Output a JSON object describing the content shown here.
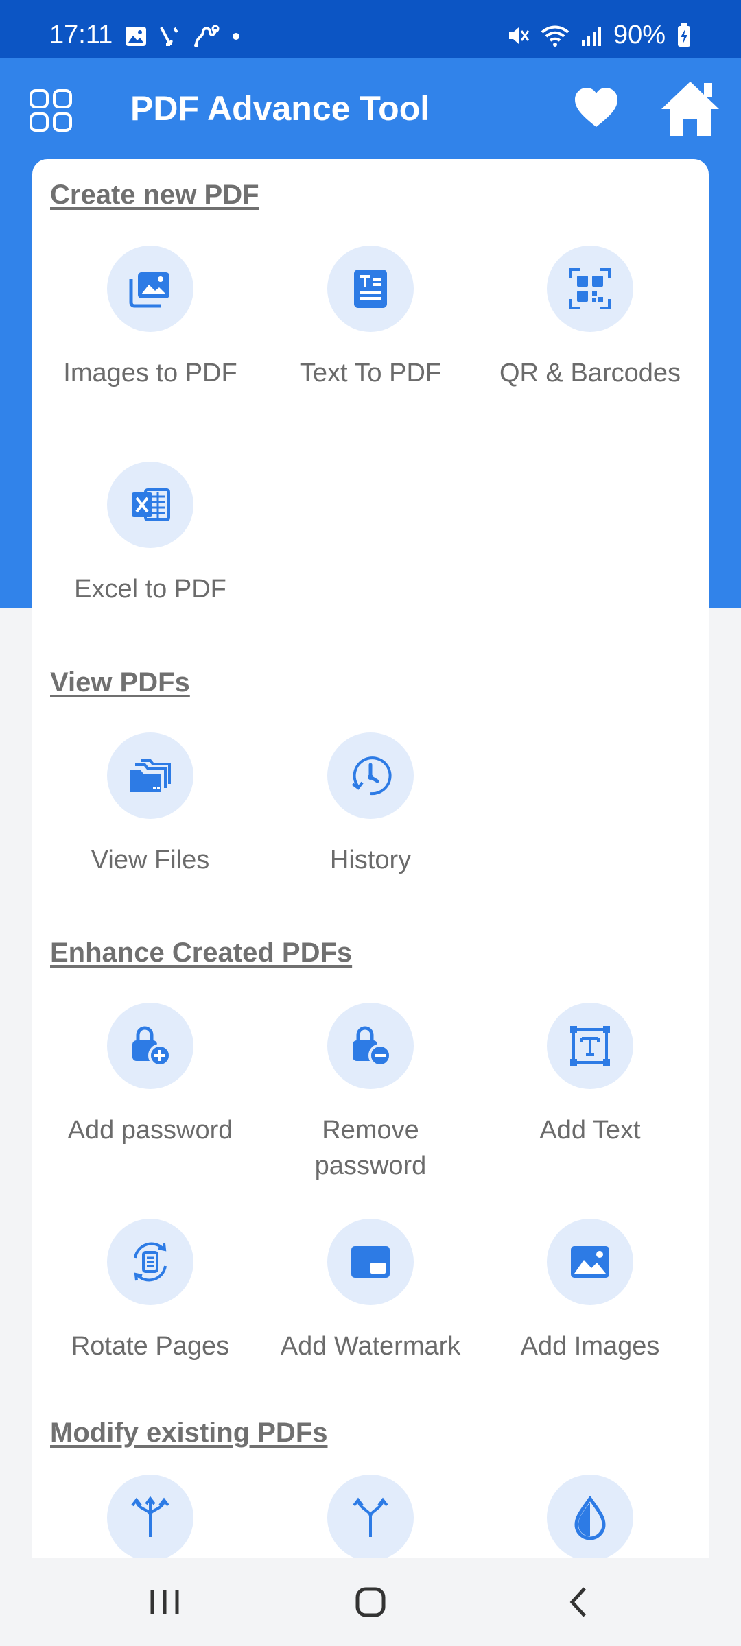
{
  "status_bar": {
    "time": "17:11",
    "battery": "90%"
  },
  "header": {
    "title": "PDF Advance Tool",
    "colors": {
      "bar": "#3183ea",
      "status": "#0c55c4",
      "icon_bg": "#e2ecfb",
      "icon": "#2d7be5"
    }
  },
  "sections": {
    "create": {
      "title": "Create new PDF"
    },
    "view": {
      "title": "View PDFs"
    },
    "enhance": {
      "title": "Enhance Created PDFs"
    },
    "modify": {
      "title": "Modify existing PDFs"
    }
  },
  "tools": {
    "images_to_pdf": "Images to PDF",
    "text_to_pdf": "Text To PDF",
    "qr_barcodes": "QR & Barcodes",
    "excel_to_pdf": "Excel to PDF",
    "view_files": "View Files",
    "history": "History",
    "add_password": "Add password",
    "remove_password": "Remove password",
    "add_text": "Add Text",
    "rotate_pages": "Rotate Pages",
    "add_watermark": "Add Watermark",
    "add_images": "Add Images"
  },
  "icons": {
    "header": [
      "grid-menu-icon",
      "heart-icon",
      "home-icon"
    ],
    "tools": [
      "images-icon",
      "text-document-icon",
      "qr-code-icon",
      "excel-icon",
      "folders-icon",
      "history-clock-icon",
      "lock-add-icon",
      "lock-remove-icon",
      "text-frame-icon",
      "rotate-page-icon",
      "watermark-icon",
      "image-icon",
      "merge-arrows-icon",
      "split-arrows-icon",
      "water-drop-icon"
    ],
    "nav": [
      "recent-apps-icon",
      "home-circle-icon",
      "back-chevron-icon"
    ]
  }
}
